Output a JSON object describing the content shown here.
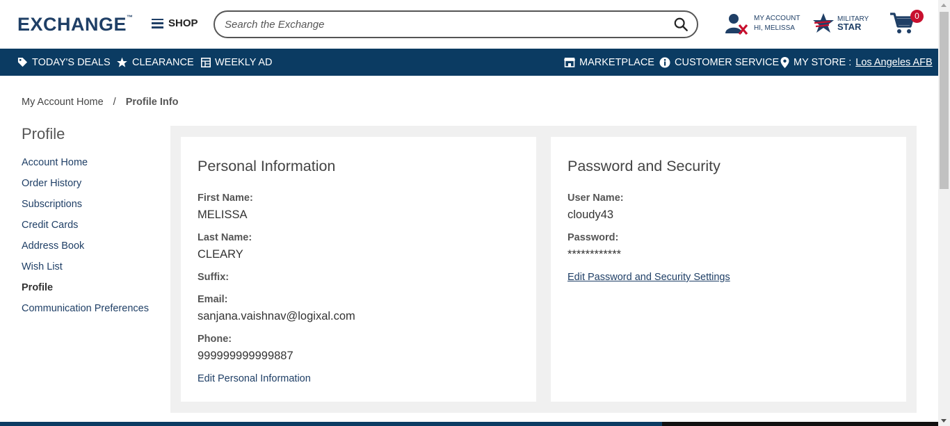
{
  "header": {
    "logo_text": "EXCHANGE",
    "shop_label": "SHOP",
    "search_placeholder": "Search the Exchange",
    "account_line1": "MY ACCOUNT",
    "account_line2": "HI, MELISSA",
    "military_line1": "MILITARY",
    "military_line2": "STAR",
    "cart_count": "0"
  },
  "nav": {
    "todays_deals": "TODAY'S DEALS",
    "clearance": "CLEARANCE",
    "weekly_ad": "WEEKLY AD",
    "marketplace": "MARKETPLACE",
    "customer_service": "CUSTOMER SERVICE",
    "my_store_label": "MY STORE :",
    "my_store_value": "Los Angeles AFB"
  },
  "breadcrumb": {
    "home": "My Account Home",
    "separator": "/",
    "current": "Profile Info"
  },
  "sidebar": {
    "title": "Profile",
    "items": [
      {
        "label": "Account Home"
      },
      {
        "label": "Order History"
      },
      {
        "label": "Subscriptions"
      },
      {
        "label": "Credit Cards"
      },
      {
        "label": "Address Book"
      },
      {
        "label": "Wish List"
      },
      {
        "label": "Profile"
      },
      {
        "label": "Communication Preferences"
      }
    ]
  },
  "personal": {
    "title": "Personal Information",
    "first_name_label": "First Name:",
    "first_name": "MELISSA",
    "last_name_label": "Last Name:",
    "last_name": "CLEARY",
    "suffix_label": "Suffix:",
    "email_label": "Email:",
    "email": "sanjana.vaishnav@logixal.com",
    "phone_label": "Phone:",
    "phone": "999999999999887",
    "edit_link": "Edit Personal Information"
  },
  "security": {
    "title": "Password and Security",
    "username_label": "User Name:",
    "username": "cloudy43",
    "password_label": "Password:",
    "password": "************",
    "edit_link": "Edit Password and Security Settings"
  },
  "colors": {
    "brand_navy": "#0b3b62",
    "logo_blue": "#1f3f66",
    "badge_red": "#c8102e"
  }
}
